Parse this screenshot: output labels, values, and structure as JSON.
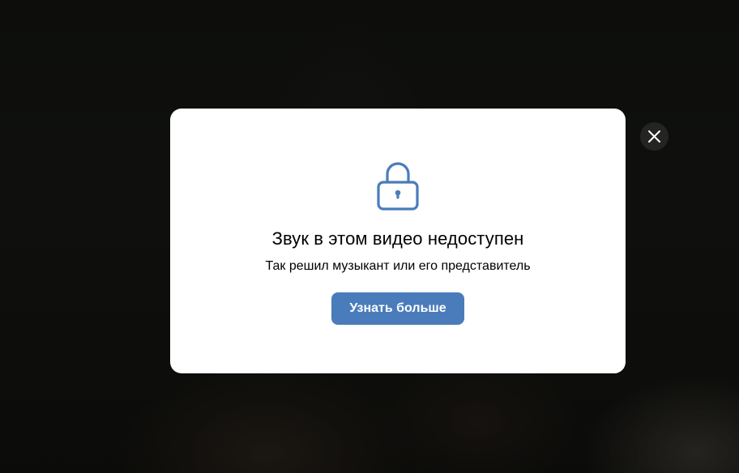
{
  "modal": {
    "title": "Звук в этом видео недоступен",
    "subtitle": "Так решил музыкант или его представитель",
    "button_label": "Узнать больше",
    "icon": "lock-icon",
    "close_icon": "close-icon"
  },
  "colors": {
    "accent": "#4a7cbb",
    "icon_stroke": "#4a7cbb",
    "dialog_bg": "#ffffff",
    "backdrop": "#141613"
  }
}
